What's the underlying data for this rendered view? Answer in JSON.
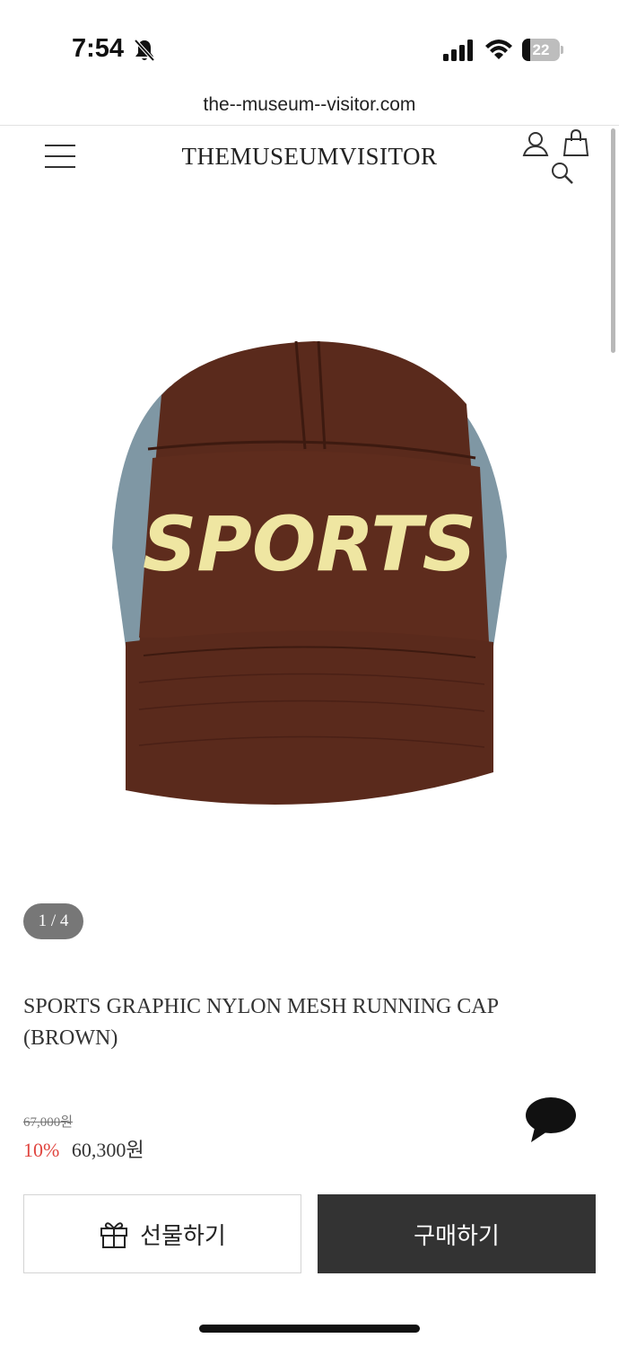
{
  "status_bar": {
    "time": "7:54",
    "battery": "22",
    "battery_level": 0.22,
    "icons": [
      "bell-slash-icon",
      "signal-icon",
      "wifi-icon",
      "battery-icon"
    ]
  },
  "browser": {
    "url": "the--museum--visitor.com"
  },
  "header": {
    "brand": "THEMUSEUMVISITOR",
    "icons": [
      "hamburger-menu-icon",
      "user-icon",
      "shopping-bag-icon",
      "search-icon"
    ]
  },
  "product": {
    "image_text": "SPORTS",
    "image_counter": "1 / 4",
    "name": "SPORTS GRAPHIC NYLON MESH RUNNING CAP (BROWN)",
    "original_price": "67,000원",
    "discount": "10%",
    "sale_price": "60,300원"
  },
  "actions": {
    "gift_label": "선물하기",
    "buy_label": "구매하기"
  },
  "colors": {
    "discount": "#e0453f",
    "buy_button": "#333333",
    "cap_brown": "#5a2a1c",
    "cap_mesh": "#7f97a4",
    "cap_text": "#efe6a2"
  }
}
